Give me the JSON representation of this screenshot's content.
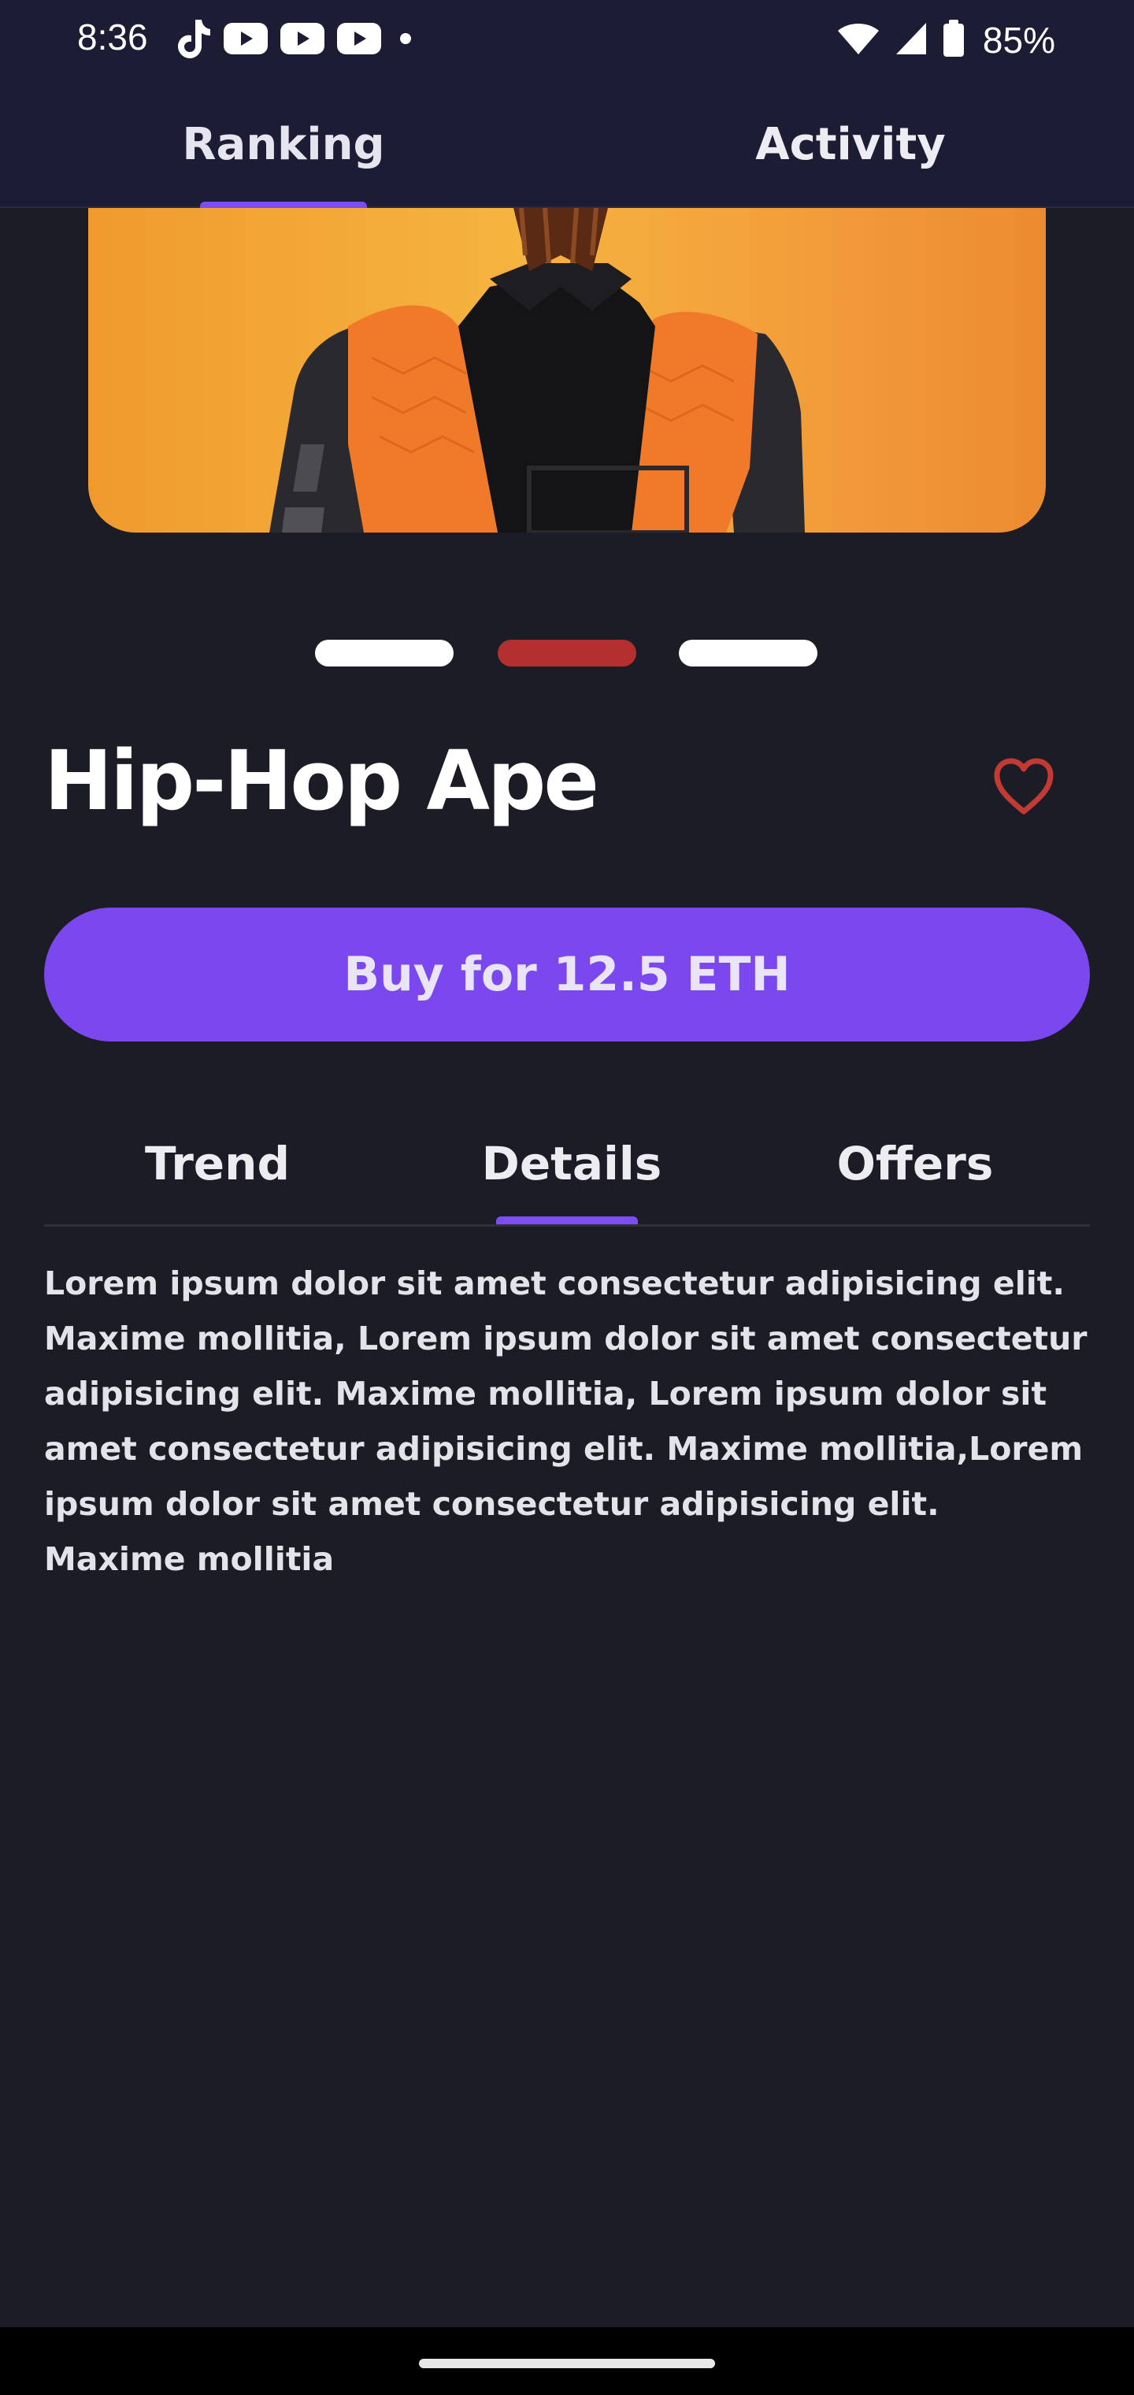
{
  "status_bar": {
    "time": "8:36",
    "battery": "85%",
    "icons_left": [
      "tiktok-icon",
      "youtube-icon",
      "youtube-icon",
      "youtube-icon",
      "dot-icon"
    ],
    "icons_right": [
      "wifi-icon",
      "signal-icon",
      "battery-icon"
    ]
  },
  "top_tabs": {
    "items": [
      {
        "label": "Ranking",
        "active": true
      },
      {
        "label": "Activity",
        "active": false
      }
    ],
    "accent": "#7b4df2"
  },
  "carousel": {
    "count": 3,
    "active_index": 1,
    "active_color": "#b3302e",
    "inactive_color": "#ffffff"
  },
  "nft": {
    "title": "Hip-Hop Ape",
    "favorite": false
  },
  "buy_button": {
    "label": "Buy for 12.5 ETH",
    "color": "#7b48ef"
  },
  "sub_tabs": {
    "items": [
      {
        "label": "Trend",
        "active": false
      },
      {
        "label": "Details",
        "active": true
      },
      {
        "label": "Offers",
        "active": false
      }
    ]
  },
  "details": {
    "description": "Lorem ipsum dolor sit amet consectetur adipisicing elit. Maxime mollitia, Lorem ipsum dolor sit amet consectetur adipisicing elit. Maxime mollitia, Lorem ipsum dolor sit amet consectetur adipisicing elit. Maxime mollitia,Lorem ipsum dolor sit amet consectetur adipisicing elit. Maxime mollitia"
  }
}
